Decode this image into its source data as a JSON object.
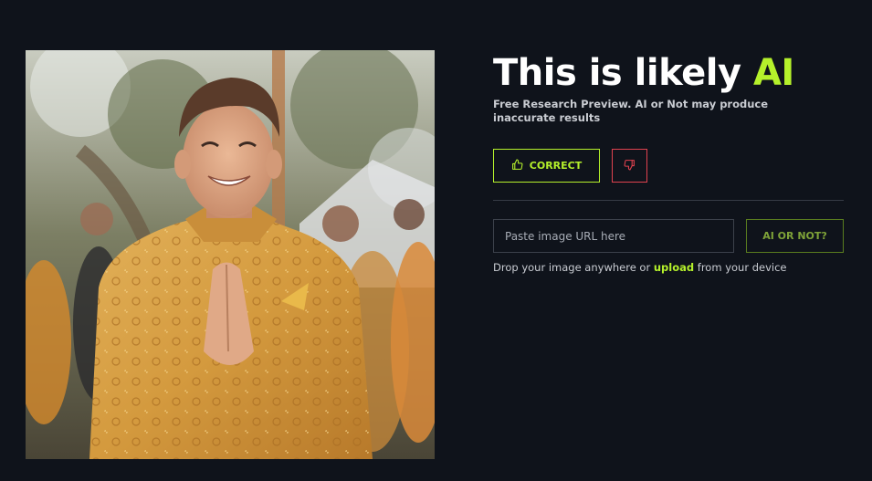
{
  "result": {
    "headline_prefix": "This is likely ",
    "headline_accent": "AI",
    "disclaimer": "Free Research Preview. AI or Not may produce inaccurate results"
  },
  "feedback": {
    "correct_label": "CORRECT",
    "correct_icon": "thumbs-up-icon",
    "wrong_icon": "thumbs-down-icon"
  },
  "url_check": {
    "placeholder": "Paste image URL here",
    "value": "",
    "submit_label": "AI OR NOT?"
  },
  "drop": {
    "prefix": "Drop your image anywhere or ",
    "link": "upload",
    "suffix": " from your device"
  },
  "colors": {
    "background": "#0f131b",
    "accent": "#b5f12b",
    "danger": "#e0424f",
    "border": "#3c414b"
  }
}
